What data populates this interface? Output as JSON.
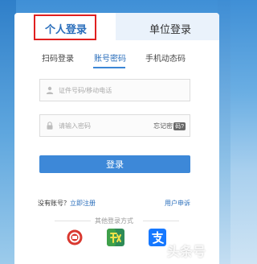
{
  "tabs": {
    "personal_label": "个人登录",
    "unit_label": "单位登录"
  },
  "subtabs": {
    "qr_label": "扫码登录",
    "account_label": "账号密码",
    "phone_label": "手机动态码"
  },
  "form": {
    "username_placeholder": "证件号码/移动电话",
    "password_placeholder": "请输入密码",
    "forgot_label": "忘记密",
    "forgot_badge": "码?"
  },
  "login_button_label": "登录",
  "footer": {
    "no_account_label": "没有账号？",
    "register_label": "立即注册",
    "user_appeal_label": "用户申诉",
    "other_login_label": "其他登录方式"
  },
  "watermark_text": "头条号",
  "colors": {
    "accent": "#3d88d8",
    "highlight_border": "#e02020",
    "link": "#2a6ebb"
  }
}
